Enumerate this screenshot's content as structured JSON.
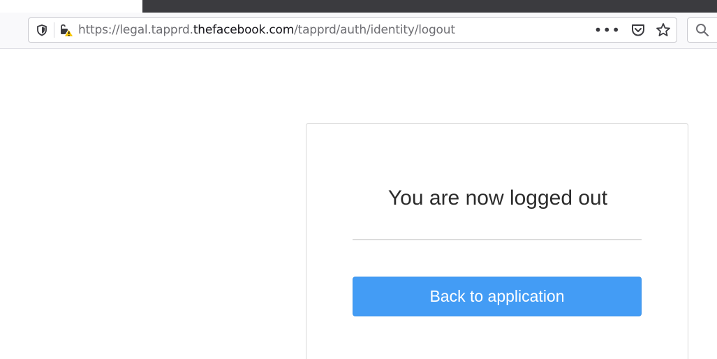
{
  "browser": {
    "url_prefix": "https://legal.tapprd.",
    "url_domain": "thefacebook.com",
    "url_path": "/tapprd/auth/identity/logout",
    "more_menu_label": "•••"
  },
  "icons": {
    "tracking_protection": "shield-icon",
    "connection": "insecure-lock-icon",
    "pocket": "pocket-icon",
    "bookmark": "star-icon",
    "search": "search-icon"
  },
  "page": {
    "title": "You are now logged out",
    "button_label": "Back to application"
  },
  "colors": {
    "button_bg": "#439cf5",
    "warning": "#f5c400"
  }
}
